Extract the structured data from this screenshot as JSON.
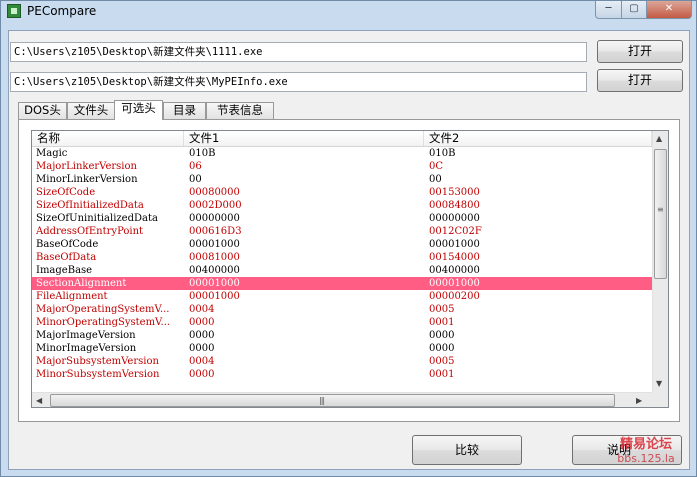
{
  "window": {
    "title": "PECompare",
    "controls": {
      "minimize": "─",
      "maximize": "▢",
      "close": "✕"
    }
  },
  "files": {
    "path1": "C:\\Users\\z105\\Desktop\\新建文件夹\\1111.exe",
    "path2": "C:\\Users\\z105\\Desktop\\新建文件夹\\MyPEInfo.exe",
    "open_label": "打开"
  },
  "tabs": [
    {
      "label": "DOS头"
    },
    {
      "label": "文件头"
    },
    {
      "label": "可选头"
    },
    {
      "label": "目录"
    },
    {
      "label": "节表信息"
    }
  ],
  "active_tab": "可选头",
  "table": {
    "columns": [
      "名称",
      "文件1",
      "文件2"
    ],
    "rows": [
      {
        "name": "Magic",
        "f1": "010B",
        "f2": "010B",
        "diff": false
      },
      {
        "name": "MajorLinkerVersion",
        "f1": "06",
        "f2": "0C",
        "diff": true
      },
      {
        "name": "MinorLinkerVersion",
        "f1": "00",
        "f2": "00",
        "diff": false
      },
      {
        "name": "SizeOfCode",
        "f1": "00080000",
        "f2": "00153000",
        "diff": true
      },
      {
        "name": "SizeOfInitializedData",
        "f1": "0002D000",
        "f2": "00084800",
        "diff": true
      },
      {
        "name": "SizeOfUninitializedData",
        "f1": "00000000",
        "f2": "00000000",
        "diff": false
      },
      {
        "name": "AddressOfEntryPoint",
        "f1": "000616D3",
        "f2": "0012C02F",
        "diff": true
      },
      {
        "name": "BaseOfCode",
        "f1": "00001000",
        "f2": "00001000",
        "diff": false
      },
      {
        "name": "BaseOfData",
        "f1": "00081000",
        "f2": "00154000",
        "diff": true
      },
      {
        "name": "ImageBase",
        "f1": "00400000",
        "f2": "00400000",
        "diff": false
      },
      {
        "name": "SectionAlignment",
        "f1": "00001000",
        "f2": "00001000",
        "diff": false,
        "selected": true
      },
      {
        "name": "FileAlignment",
        "f1": "00001000",
        "f2": "00000200",
        "diff": true
      },
      {
        "name": "MajorOperatingSystemV...",
        "f1": "0004",
        "f2": "0005",
        "diff": true
      },
      {
        "name": "MinorOperatingSystemV...",
        "f1": "0000",
        "f2": "0001",
        "diff": true
      },
      {
        "name": "MajorImageVersion",
        "f1": "0000",
        "f2": "0000",
        "diff": false
      },
      {
        "name": "MinorImageVersion",
        "f1": "0000",
        "f2": "0000",
        "diff": false
      },
      {
        "name": "MajorSubsystemVersion",
        "f1": "0004",
        "f2": "0005",
        "diff": true
      },
      {
        "name": "MinorSubsystemVersion",
        "f1": "0000",
        "f2": "0001",
        "diff": true
      }
    ]
  },
  "buttons": {
    "compare": "比较",
    "help": "说明"
  },
  "watermark": {
    "line1": "精易论坛",
    "line2": "bbs.125.la"
  },
  "colors": {
    "diff_text": "#c00000",
    "selected_row": "#ff5d84"
  }
}
